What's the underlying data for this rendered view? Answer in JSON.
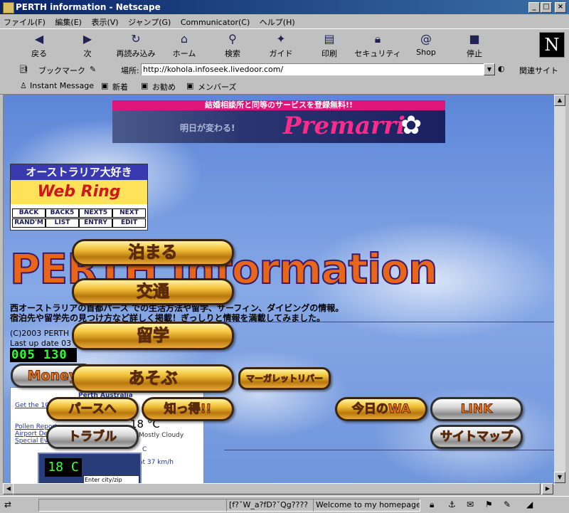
{
  "window": {
    "title": "PERTH  information - Netscape",
    "buttons": {
      "minimize": "_",
      "maximize": "□",
      "close": "×"
    }
  },
  "menu": [
    "ファイル(F)",
    "編集(E)",
    "表示(V)",
    "ジャンプ(G)",
    "Communicator(C)",
    "ヘルプ(H)"
  ],
  "toolbar": {
    "back": "戻る",
    "forward": "次",
    "reload": "再読み込み",
    "home": "ホーム",
    "search": "検索",
    "guide": "ガイド",
    "print": "印刷",
    "security": "セキュリティ",
    "shop": "Shop",
    "stop": "停止",
    "logo": "N"
  },
  "location": {
    "bookmarks": "ブックマーク",
    "label": "場所:",
    "url": "http://kohola.infoseek.livedoor.com/",
    "related": "関連サイト"
  },
  "personal": {
    "instant_message": "Instant Message",
    "new": "新着",
    "recommend": "お勧め",
    "members": "メンバーズ"
  },
  "banner": {
    "headline": "結婚相談所と同等のサービスを登録無料!!",
    "subtitle": "明日が変わる!",
    "brand": "Premarri"
  },
  "webring": {
    "title_top": "オーストラリア大好き",
    "title_bottom": "Web Ring",
    "links": [
      "BACK",
      "BACK5",
      "NEXT5",
      "NEXT",
      "RAND'M",
      "LIST",
      "ENTRY",
      "EDIT"
    ]
  },
  "page": {
    "big_title": "PERTH Information",
    "desc_line1": "西オーストラリアの首都パース での生活方法や留学、サーフィン、ダイビングの情報。",
    "desc_line2": "宿泊先や留学先の見つけ方など詳しく掲載！ぎっしりと情報を満載してみました。",
    "copyright": "(C)2003 PERTH",
    "last_update": "Last up date 03",
    "counter": "005 130"
  },
  "weather": {
    "city": "Perth  Australia",
    "link1": "Get the 10",
    "link2": "Pollen Report",
    "link3": "Airport Delays",
    "link4": "Special Events",
    "temp": "18 °C",
    "condition": "Mostly Cloudy",
    "wind": "at 37 km/h",
    "c_label": "C",
    "clock_temp": "18 C",
    "city_input_placeholder": "Enter city/zip"
  },
  "nav_buttons": {
    "stay": "泊まる",
    "transport": "交通",
    "study": "留学",
    "play": "あそぶ",
    "money": "Money",
    "margaret": "マーガレットリバー",
    "to_perth": "パースへ",
    "know": "知っ得!!",
    "today_wa": "今日のWA",
    "link": "LINK",
    "trouble": "トラブル",
    "sitemap": "サイトマップ"
  },
  "status": {
    "text1": "[f?ˇW_a?fD?ˇQg????",
    "text2": "Welcome to my homepage"
  }
}
